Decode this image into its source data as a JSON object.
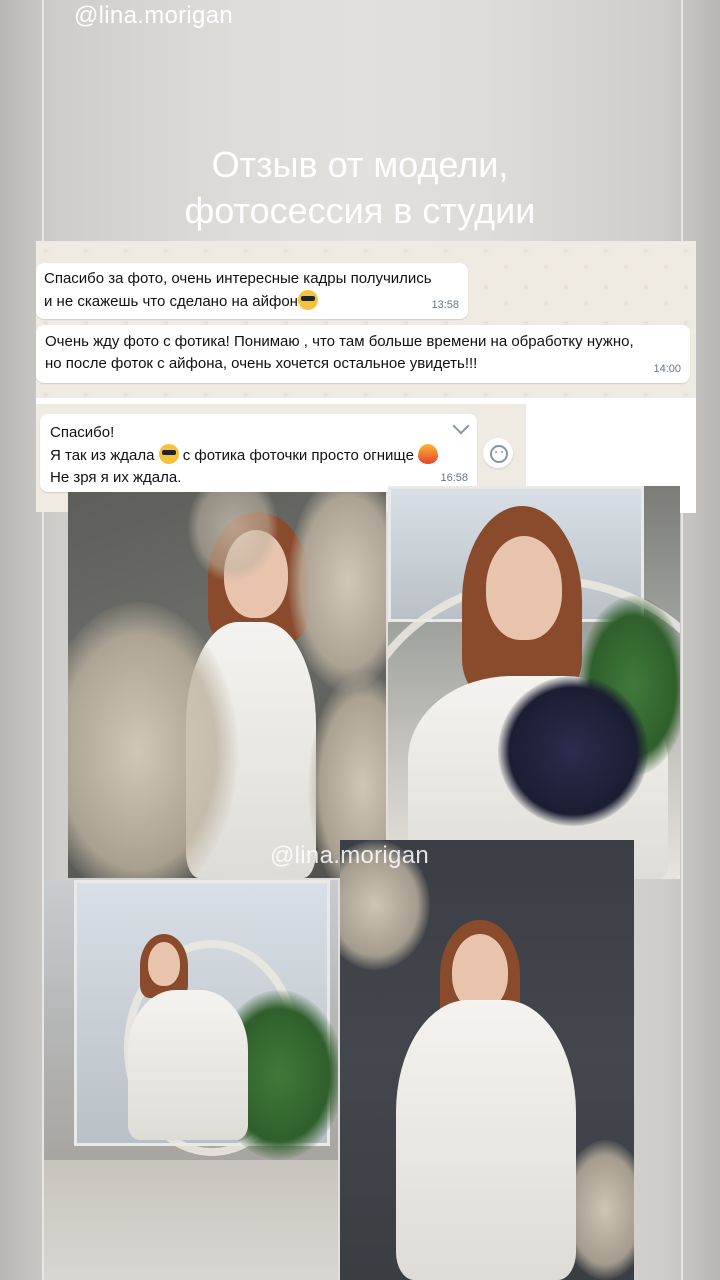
{
  "story": {
    "handle_top": "@lina.morigan",
    "title_line1": "Отзыв от модели,",
    "title_line2": "фотосессия в студии",
    "handle_watermark": "@lina.morigan"
  },
  "chat": {
    "messages": [
      {
        "line1": "Спасибо за фото, очень интересные кадры получились",
        "line2": "и не скажешь что сделано на айфон",
        "emoji": "smiling-face-with-sunglasses",
        "time": "13:58"
      },
      {
        "line1": "Очень жду фото с фотика! Понимаю , что там больше времени на обработку нужно,",
        "line2": "но после фоток с айфона, очень хочется остальное увидеть!!!",
        "time": "14:00"
      },
      {
        "line1": "Спасибо!",
        "line2a": "Я так из ждала",
        "line2b": "с фотика фоточки просто огнище",
        "line3": "Не зря я их ждала.",
        "emoji1": "smiling-face-with-sunglasses",
        "emoji2": "fire",
        "time": "16:58"
      }
    ]
  },
  "colors": {
    "chat_bg": "#efeae2",
    "bubble": "#ffffff",
    "time_text": "#667781"
  }
}
